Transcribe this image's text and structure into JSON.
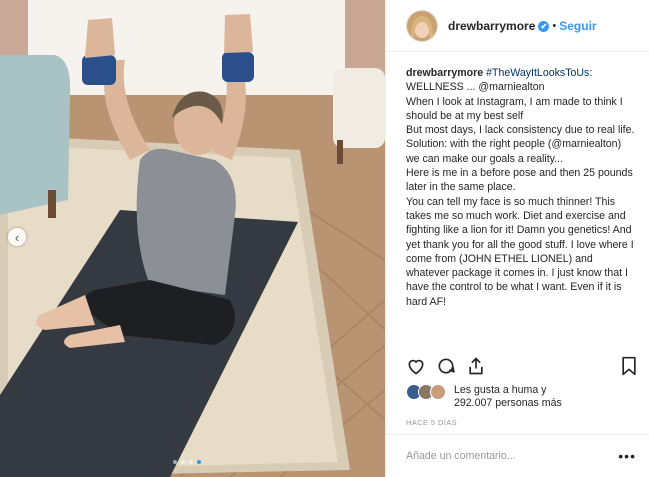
{
  "media": {
    "carousel_dots": 4,
    "active_dot_index": 3,
    "prev_glyph": "‹"
  },
  "header": {
    "username": "drewbarrymore",
    "separator": "•",
    "follow_label": "Seguir",
    "verified_glyph": "✔"
  },
  "caption": {
    "username": "drewbarrymore",
    "hashtag": "#TheWayItLooksToUs:",
    "lines": [
      "WELLNESS ... @marniealton",
      "When I look at Instagram, I am made to think I should be at my best self",
      "But most days, I lack consistency due to real life.",
      "Solution: with the right people (@marniealton) we can make our goals a reality...",
      "Here is me in a before pose and then 25 pounds later in the same place.",
      "You can tell my face is so much thinner! This takes me so much work. Diet and exercise and fighting like a lion for it! Damn you genetics! And yet thank you for all the good stuff. I love where I come from (JOHN ETHEL LIONEL) and whatever package it comes in. I just know that I have the control to be what I want. Even if it is hard AF!"
    ]
  },
  "likes": {
    "line1": "Les gusta a huma y",
    "line2": "292.007 personas más"
  },
  "timestamp": "HACE 5 DÍAS",
  "comment": {
    "placeholder": "Añade un comentario...",
    "more_glyph": "•••"
  },
  "icons": [
    "heart-icon",
    "comment-icon",
    "share-icon",
    "bookmark-icon"
  ],
  "colors": {
    "link": "#3897f0",
    "text": "#262626",
    "muted": "#999999"
  }
}
